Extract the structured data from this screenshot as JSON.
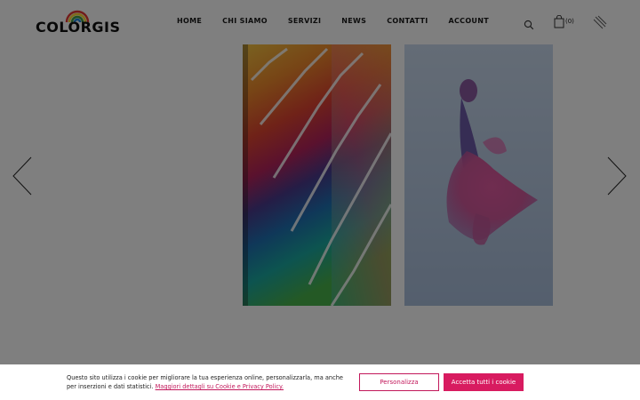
{
  "brand": {
    "name": "COLORGIS",
    "accent": "#d81b60"
  },
  "nav": {
    "items": [
      "HOME",
      "CHI SIAMO",
      "SERVIZI",
      "NEWS",
      "CONTATTI",
      "ACCOUNT"
    ]
  },
  "header": {
    "search_icon": "search-icon",
    "cart_icon": "shopping-bag-icon",
    "cart_count": "(0)",
    "menu_icon": "menu-lines-icon"
  },
  "slider": {
    "prev_icon": "chevron-left-icon",
    "next_icon": "chevron-right-icon",
    "slides": [
      "color-swatches-image",
      "pink-betta-fish-image"
    ]
  },
  "cookie": {
    "text": "Questo sito utilizza i cookie per migliorare la tua esperienza online, personalizzarla, ma anche per inserzioni e dati statistici.",
    "link": "Maggiori dettagli su Cookie e Privacy Policy.",
    "customize_label": "Personalizza",
    "accept_label": "Accetta tutti i cookie"
  }
}
